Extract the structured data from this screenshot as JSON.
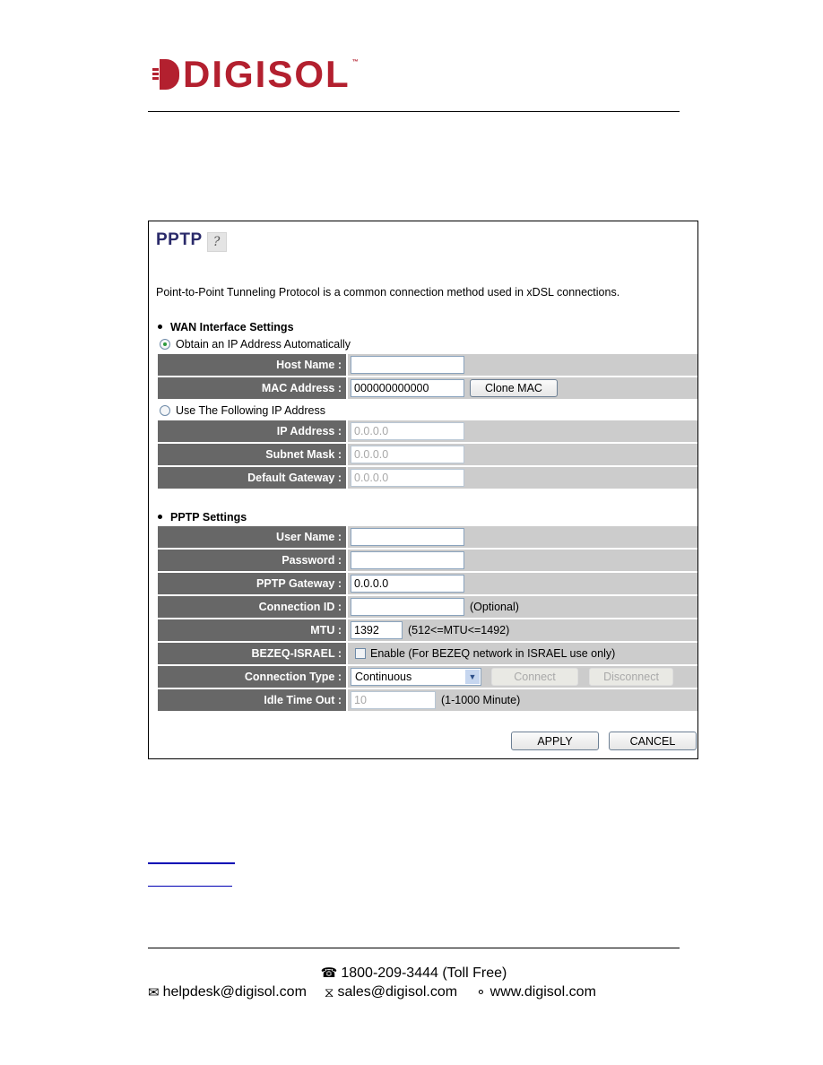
{
  "brand": {
    "name": "DIGISOL",
    "trademark": "™",
    "color": "#b3202f"
  },
  "panel": {
    "title": "PPTP",
    "help_icon": "help-icon",
    "description": "Point-to-Point Tunneling Protocol is a common connection method used in xDSL connections.",
    "wan_section": {
      "heading": "WAN Interface Settings",
      "option_auto": {
        "label": "Obtain an IP Address Automatically",
        "selected": true
      },
      "host_name": {
        "label": "Host Name :",
        "value": ""
      },
      "mac_address": {
        "label": "MAC Address :",
        "value": "000000000000",
        "button": "Clone MAC"
      },
      "option_static": {
        "label": "Use The Following IP Address",
        "selected": false
      },
      "ip_address": {
        "label": "IP Address :",
        "value": "0.0.0.0"
      },
      "subnet_mask": {
        "label": "Subnet Mask :",
        "value": "0.0.0.0"
      },
      "default_gateway": {
        "label": "Default Gateway :",
        "value": "0.0.0.0"
      }
    },
    "pptp_section": {
      "heading": "PPTP Settings",
      "user_name": {
        "label": "User Name :",
        "value": ""
      },
      "password": {
        "label": "Password :",
        "value": ""
      },
      "pptp_gateway": {
        "label": "PPTP Gateway :",
        "value": "0.0.0.0"
      },
      "connection_id": {
        "label": "Connection ID :",
        "value": "",
        "hint": "(Optional)"
      },
      "mtu": {
        "label": "MTU :",
        "value": "1392",
        "hint": "(512<=MTU<=1492)"
      },
      "bezeq": {
        "label": "BEZEQ-ISRAEL :",
        "checked": false,
        "checkbox_label": "Enable (For BEZEQ network in ISRAEL use only)"
      },
      "connection_type": {
        "label": "Connection Type :",
        "selected": "Continuous",
        "connect_button": "Connect",
        "disconnect_button": "Disconnect"
      },
      "idle_time_out": {
        "label": "Idle Time Out :",
        "value": "10",
        "hint": "(1-1000 Minute)"
      }
    },
    "actions": {
      "apply": "APPLY",
      "cancel": "CANCEL"
    }
  },
  "links": [
    "",
    ""
  ],
  "footer": {
    "phone_icon": "☎",
    "phone": "1800-209-3444 (Toll Free)",
    "email_icon": "✉",
    "helpdesk": "helpdesk@digisol.com",
    "sales_icon": "⧖",
    "sales": "sales@digisol.com",
    "web_icon": "🌍",
    "website": "www.digisol.com"
  }
}
